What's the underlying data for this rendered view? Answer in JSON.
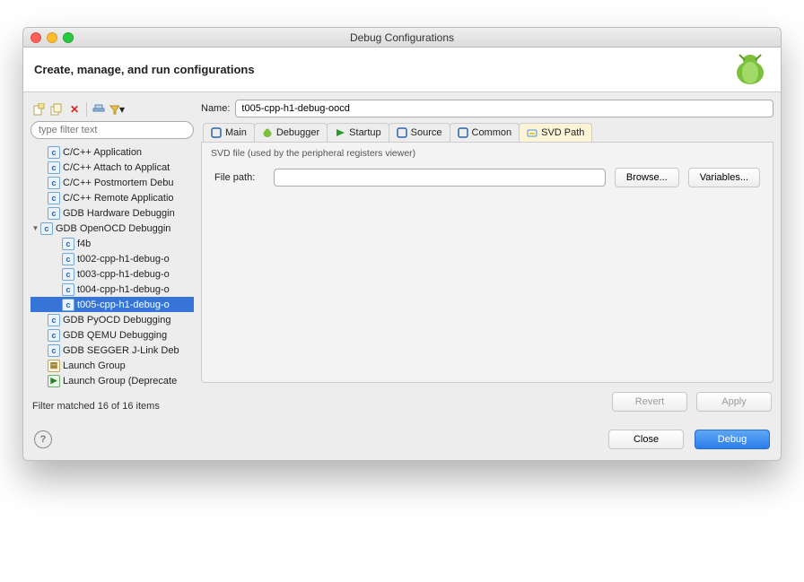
{
  "window_title": "Debug Configurations",
  "header_title": "Create, manage, and run configurations",
  "filter_placeholder": "type filter text",
  "tree": [
    {
      "indent": 1,
      "icon": "c",
      "label": "C/C++ Application"
    },
    {
      "indent": 1,
      "icon": "c",
      "label": "C/C++ Attach to Applicat"
    },
    {
      "indent": 1,
      "icon": "c",
      "label": "C/C++ Postmortem Debu"
    },
    {
      "indent": 1,
      "icon": "c",
      "label": "C/C++ Remote Applicatio"
    },
    {
      "indent": 1,
      "icon": "c",
      "label": "GDB Hardware Debuggin"
    },
    {
      "indent": 0,
      "icon": "c",
      "label": "GDB OpenOCD Debuggin",
      "expanded": true
    },
    {
      "indent": 2,
      "icon": "c",
      "label": "f4b"
    },
    {
      "indent": 2,
      "icon": "c",
      "label": "t002-cpp-h1-debug-o"
    },
    {
      "indent": 2,
      "icon": "c",
      "label": "t003-cpp-h1-debug-o"
    },
    {
      "indent": 2,
      "icon": "c",
      "label": "t004-cpp-h1-debug-o"
    },
    {
      "indent": 2,
      "icon": "c",
      "label": "t005-cpp-h1-debug-o",
      "selected": true
    },
    {
      "indent": 1,
      "icon": "c",
      "label": "GDB PyOCD Debugging"
    },
    {
      "indent": 1,
      "icon": "c",
      "label": "GDB QEMU Debugging"
    },
    {
      "indent": 1,
      "icon": "c",
      "label": "GDB SEGGER J-Link Deb"
    },
    {
      "indent": 1,
      "icon": "group",
      "label": "Launch Group"
    },
    {
      "indent": 1,
      "icon": "grpdep",
      "label": "Launch Group (Deprecate"
    }
  ],
  "filter_status": "Filter matched 16 of 16 items",
  "name_label": "Name:",
  "name_value": "t005-cpp-h1-debug-oocd",
  "tabs": [
    {
      "label": "Main",
      "icon_color": "#2a64a7"
    },
    {
      "label": "Debugger",
      "icon_color": "#6cab6c"
    },
    {
      "label": "Startup",
      "icon_color": "#2a7f2a"
    },
    {
      "label": "Source",
      "icon_color": "#2a64a7"
    },
    {
      "label": "Common",
      "icon_color": "#2a64a7"
    },
    {
      "label": "SVD Path",
      "icon_color": "#c7a500",
      "active": true
    }
  ],
  "panel_sub": "SVD file (used by the peripheral registers viewer)",
  "filepath_label": "File path:",
  "filepath_value": "",
  "browse_label": "Browse...",
  "variables_label": "Variables...",
  "revert_label": "Revert",
  "apply_label": "Apply",
  "close_label": "Close",
  "debug_label": "Debug"
}
